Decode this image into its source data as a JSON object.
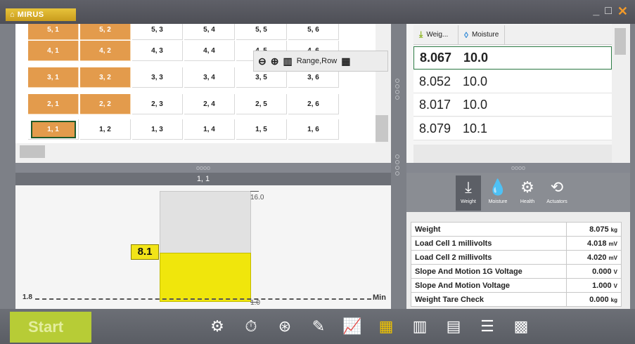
{
  "app": {
    "title": "MIRUS"
  },
  "window": {
    "minimize": "_",
    "maximize": "□",
    "close": "✕"
  },
  "grid": {
    "rows": [
      {
        "cells": [
          "5, 1",
          "5, 2",
          "5, 3",
          "5, 4",
          "5, 5",
          "5, 6"
        ]
      },
      {
        "cells": [
          "4, 1",
          "4, 2",
          "4, 3",
          "4, 4",
          "4, 5",
          "4, 6"
        ]
      },
      {
        "cells": [
          "3, 1",
          "3, 2",
          "3, 3",
          "3, 4",
          "3, 5",
          "3, 6"
        ]
      },
      {
        "cells": [
          "2, 1",
          "2, 2",
          "2, 3",
          "2, 4",
          "2, 5",
          "2, 6"
        ]
      },
      {
        "cells": [
          "1, 1",
          "1, 2",
          "1, 3",
          "1, 4",
          "1, 5",
          "1, 6"
        ]
      }
    ],
    "orange_colour": "#e39b4c",
    "selected_colour": "#1e5a2b",
    "toolbar": {
      "zoom_out": "zoom-out-icon",
      "zoom_in": "zoom-in-icon",
      "range_label": "Range,Row",
      "grid_icon": "grid-icon"
    }
  },
  "splitter": {
    "dots": "oooo"
  },
  "selected_cell": "1, 1",
  "gauge": {
    "value": "8.1",
    "max": "16.0",
    "min": "1.0",
    "threshold": "1.8",
    "threshold_label": "Min",
    "fill_fraction": 0.44,
    "fill_colour": "#f0e60c"
  },
  "list": {
    "headers": {
      "weight": "Weig...",
      "moisture": "Moisture"
    },
    "rows": [
      {
        "weight": "8.067",
        "moisture": "10.0"
      },
      {
        "weight": "8.052",
        "moisture": "10.0"
      },
      {
        "weight": "8.017",
        "moisture": "10.0"
      },
      {
        "weight": "8.079",
        "moisture": "10.1"
      }
    ]
  },
  "tabs": [
    {
      "label": "Weight",
      "icon": "download-icon",
      "glyph": "⤓"
    },
    {
      "label": "Moisture",
      "icon": "droplet-icon",
      "glyph": "💧"
    },
    {
      "label": "Health",
      "icon": "gears-icon",
      "glyph": "⚙"
    },
    {
      "label": "Actuators",
      "icon": "actuator-icon",
      "glyph": "⟲"
    }
  ],
  "measurements": [
    {
      "label": "Weight",
      "value": "8.075",
      "unit": "kg"
    },
    {
      "label": "Load Cell 1 millivolts",
      "value": "4.018",
      "unit": "mV"
    },
    {
      "label": "Load Cell 2 millivolts",
      "value": "4.020",
      "unit": "mV"
    },
    {
      "label": "Slope And Motion 1G Voltage",
      "value": "0.000",
      "unit": "V"
    },
    {
      "label": "Slope And Motion Voltage",
      "value": "1.000",
      "unit": "V"
    },
    {
      "label": "Weight Tare Check",
      "value": "0.000",
      "unit": "kg"
    }
  ],
  "bottom": {
    "start": "Start",
    "tools": [
      {
        "icon": "gears-icon",
        "glyph": "⚙",
        "active": false
      },
      {
        "icon": "stopwatch-icon",
        "glyph": "⏱",
        "active": false
      },
      {
        "icon": "compass-icon",
        "glyph": "⊛",
        "active": false
      },
      {
        "icon": "pencil-icon",
        "glyph": "✎",
        "active": false
      },
      {
        "icon": "chart-icon",
        "glyph": "📈",
        "active": false
      },
      {
        "icon": "tiles-icon",
        "glyph": "▦",
        "active": true
      },
      {
        "icon": "map-icon",
        "glyph": "▥",
        "active": false
      },
      {
        "icon": "matrix-icon",
        "glyph": "▤",
        "active": false
      },
      {
        "icon": "table-icon",
        "glyph": "☰",
        "active": false
      },
      {
        "icon": "keypad-icon",
        "glyph": "▩",
        "active": false
      }
    ]
  }
}
